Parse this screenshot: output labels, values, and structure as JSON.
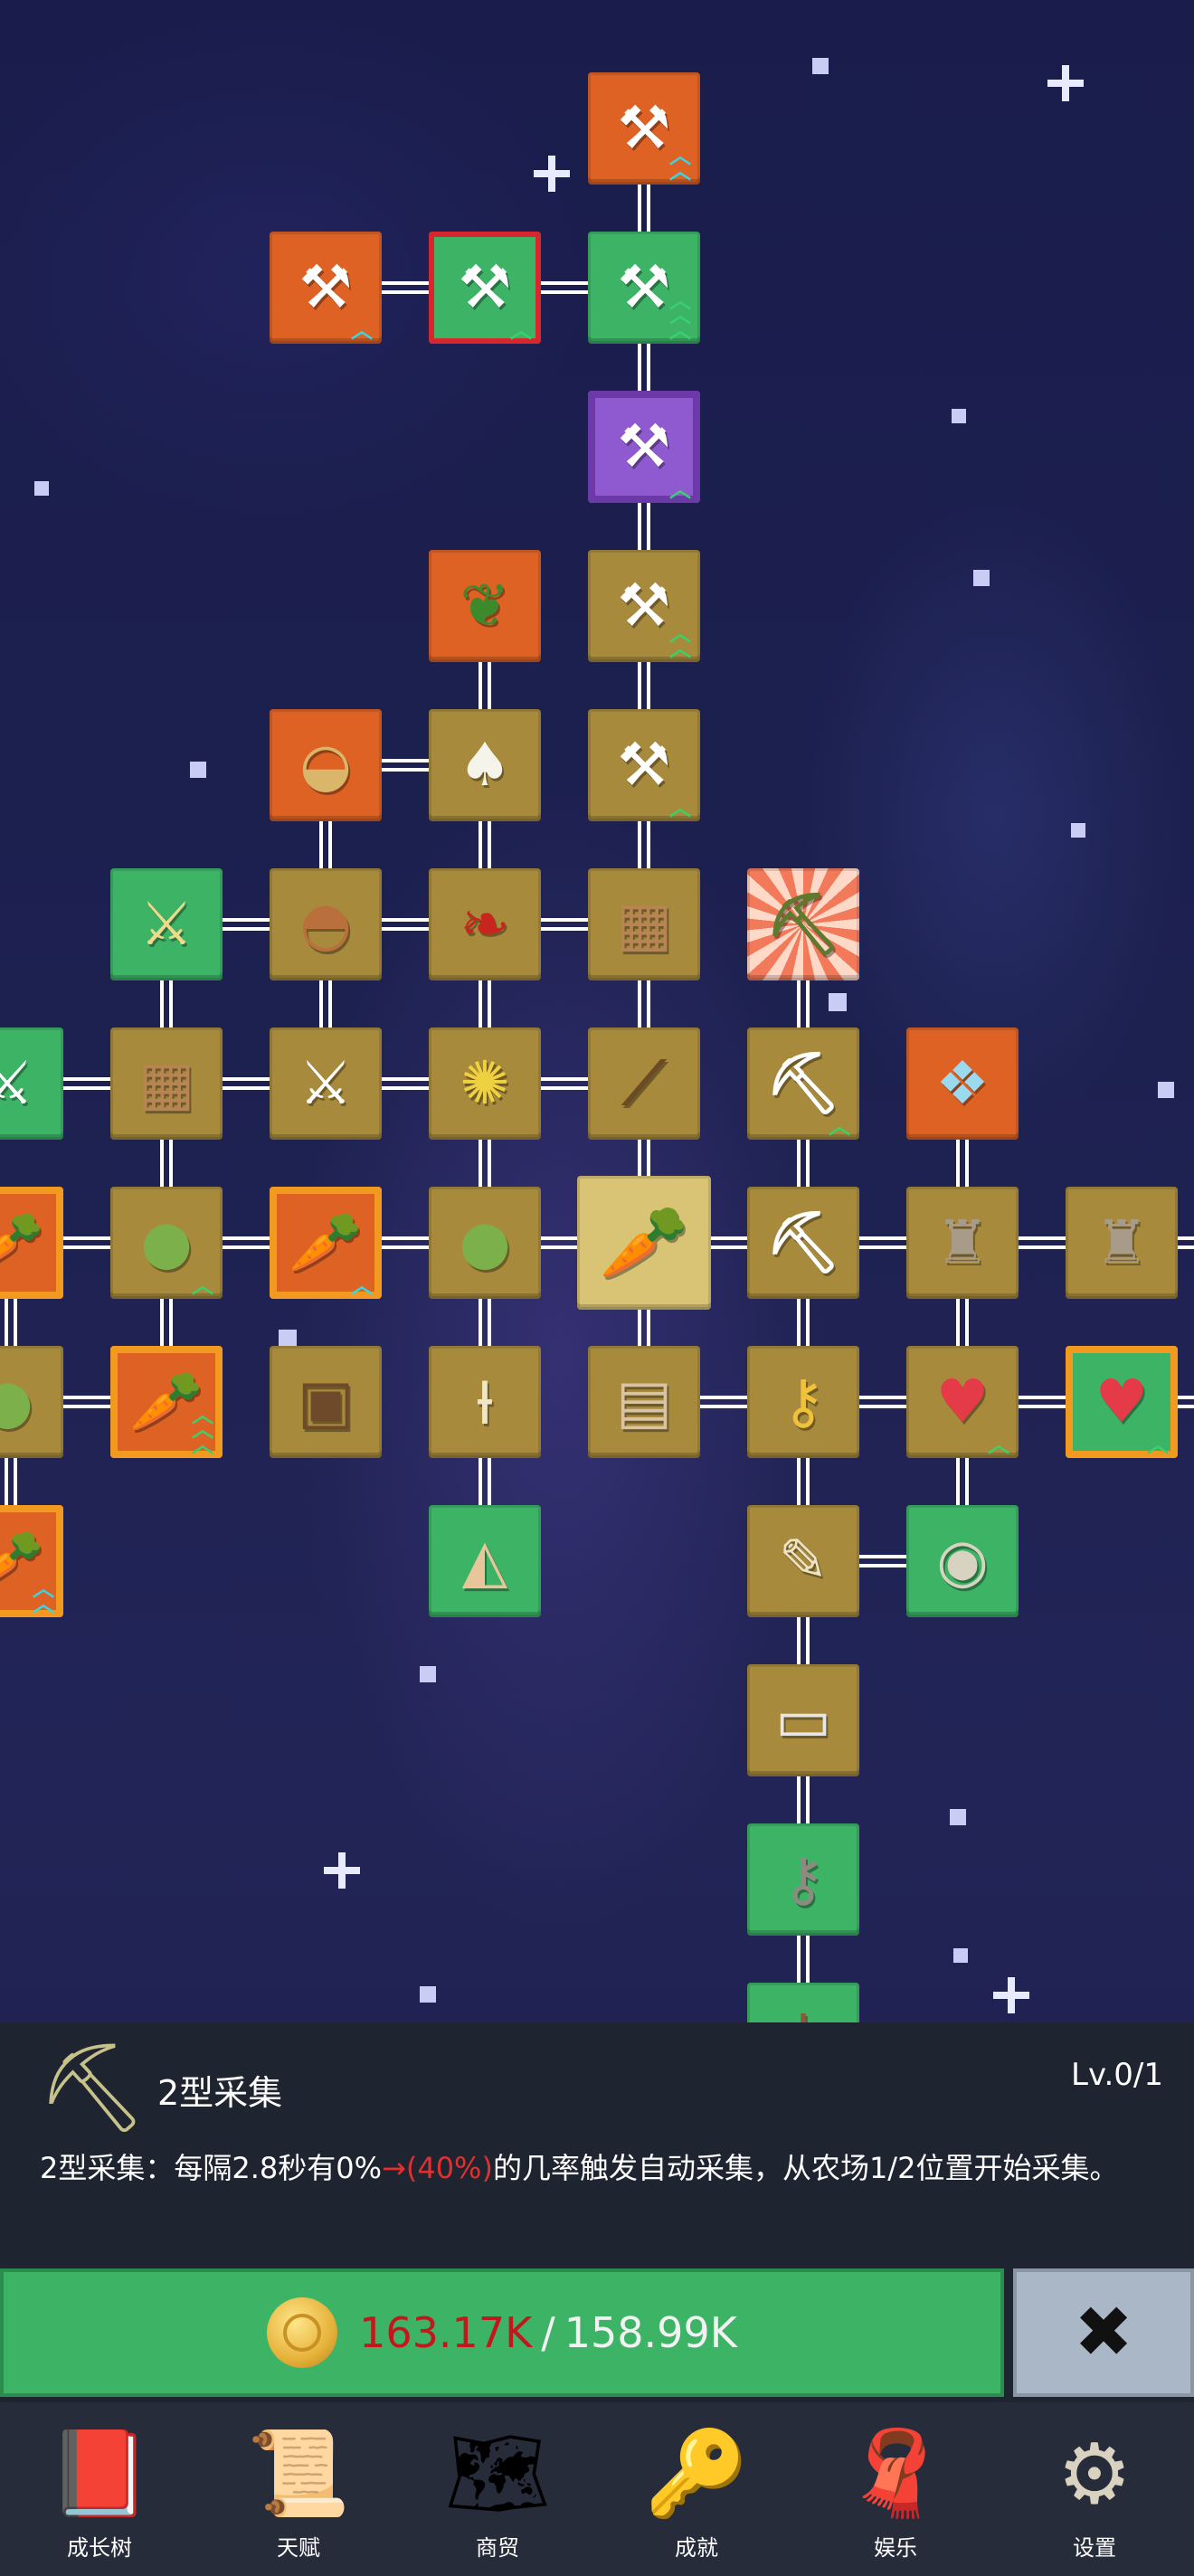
{
  "tree": {
    "nodes": [
      {
        "id": "shovel-top",
        "icon": "shovel-icon",
        "color": "orange",
        "chevrons": 2,
        "chev_color": "cyan"
      },
      {
        "id": "shovel-left",
        "icon": "shovel-icon",
        "color": "orange",
        "chevrons": 1,
        "chev_color": "cyan"
      },
      {
        "id": "shovel-red",
        "icon": "shovel-icon",
        "color": "green",
        "chevrons": 1,
        "chev_color": "green",
        "frame": "red"
      },
      {
        "id": "shovel-green",
        "icon": "shovel-icon",
        "color": "green",
        "chevrons": 3,
        "chev_color": "green"
      },
      {
        "id": "shovel-purple",
        "icon": "shovel-icon",
        "color": "brown",
        "chevrons": 1,
        "chev_color": "green",
        "frame": "purple"
      },
      {
        "id": "pepper",
        "icon": "bell-pepper-icon",
        "color": "orange"
      },
      {
        "id": "shovel-2",
        "icon": "shovel-icon",
        "color": "brown",
        "chevrons": 2,
        "chev_color": "green"
      },
      {
        "id": "soup-bowl",
        "icon": "soup-bowl-icon",
        "color": "orange"
      },
      {
        "id": "radish",
        "icon": "radish-icon",
        "color": "brown"
      },
      {
        "id": "shovel-3",
        "icon": "shovel-icon",
        "color": "brown",
        "chevrons": 1,
        "chev_color": "green"
      },
      {
        "id": "sword-green",
        "icon": "sword-icon",
        "color": "green"
      },
      {
        "id": "empty-bowl",
        "icon": "bowl-icon",
        "color": "brown"
      },
      {
        "id": "chili",
        "icon": "chili-icon",
        "color": "brown"
      },
      {
        "id": "backpack-1",
        "icon": "backpack-icon",
        "color": "brown"
      },
      {
        "id": "pickaxe-burst",
        "icon": "pickaxe-icon",
        "color": "burst"
      },
      {
        "id": "sword-edge",
        "icon": "sword-icon",
        "color": "green"
      },
      {
        "id": "backpack-2",
        "icon": "backpack-icon",
        "color": "brown"
      },
      {
        "id": "sword-2",
        "icon": "sword-icon",
        "color": "brown"
      },
      {
        "id": "corn",
        "icon": "corn-icon",
        "color": "brown"
      },
      {
        "id": "fishing-rod",
        "icon": "fishing-rod-icon",
        "color": "brown"
      },
      {
        "id": "pickaxe-2",
        "icon": "pickaxe-icon",
        "color": "brown",
        "chevrons": 1,
        "chev_color": "green"
      },
      {
        "id": "crystal",
        "icon": "crystal-icon",
        "color": "orange"
      },
      {
        "id": "carrot-edge",
        "icon": "carrot-icon",
        "color": "orange",
        "frame": "orange"
      },
      {
        "id": "cabbage-1",
        "icon": "cabbage-icon",
        "color": "brown",
        "chevrons": 1,
        "chev_color": "green"
      },
      {
        "id": "carrot-2",
        "icon": "carrot-icon",
        "color": "orange",
        "frame": "orange",
        "chevrons": 1,
        "chev_color": "cyan"
      },
      {
        "id": "cabbage-2",
        "icon": "cabbage-icon",
        "color": "brown"
      },
      {
        "id": "carrot-center",
        "icon": "carrot-icon",
        "color": "highlight"
      },
      {
        "id": "pickaxe-3",
        "icon": "pickaxe-icon",
        "color": "brown"
      },
      {
        "id": "statue-1",
        "icon": "statue-icon",
        "color": "brown"
      },
      {
        "id": "statue-2",
        "icon": "statue-icon",
        "color": "brown"
      },
      {
        "id": "cabbage-edge",
        "icon": "cabbage-icon",
        "color": "brown"
      },
      {
        "id": "carrot-3",
        "icon": "carrot-icon",
        "color": "orange",
        "frame": "orange",
        "chevrons": 3,
        "chev_color": "green"
      },
      {
        "id": "chest",
        "icon": "treasure-chest-icon",
        "color": "brown"
      },
      {
        "id": "leek",
        "icon": "leek-icon",
        "color": "brown"
      },
      {
        "id": "map",
        "icon": "map-icon",
        "color": "brown"
      },
      {
        "id": "golden-key",
        "icon": "golden-key-icon",
        "color": "brown"
      },
      {
        "id": "heart-1",
        "icon": "heart-icon",
        "color": "brown",
        "chevrons": 1,
        "chev_color": "green"
      },
      {
        "id": "heart-2",
        "icon": "heart-icon",
        "color": "green",
        "frame": "orange",
        "chevrons": 1,
        "chev_color": "green"
      },
      {
        "id": "carrot-edge-2",
        "icon": "carrot-icon",
        "color": "orange",
        "frame": "orange",
        "chevrons": 2,
        "chev_color": "cyan"
      },
      {
        "id": "pizza",
        "icon": "pizza-icon",
        "color": "green"
      },
      {
        "id": "scroll",
        "icon": "scroll-icon",
        "color": "brown"
      },
      {
        "id": "fossil",
        "icon": "fossil-icon",
        "color": "green"
      },
      {
        "id": "cassette",
        "icon": "cassette-icon",
        "color": "brown"
      },
      {
        "id": "key",
        "icon": "key-icon",
        "color": "green"
      },
      {
        "id": "cloth",
        "icon": "cloth-icon",
        "color": "green"
      }
    ]
  },
  "detail": {
    "icon": "pickaxe-icon",
    "title": "2型采集",
    "level": "Lv.0/1",
    "desc_prefix": "2型采集：每隔2.8秒有0%",
    "desc_highlight": "→(40%)",
    "desc_suffix": "的几率触发自动采集，从农场1/2位置开始采集。"
  },
  "upgrade": {
    "icon": "coin-icon",
    "cost_current": "163.17K",
    "separator": "/",
    "cost_have": "158.99K",
    "colors": {
      "insufficient": "#c4161c",
      "button": "#3db366"
    }
  },
  "close": {
    "icon": "close-x-icon",
    "glyph": "✖"
  },
  "tabs": [
    {
      "label": "成长树",
      "icon": "book-icon",
      "glyph": "📕"
    },
    {
      "label": "天赋",
      "icon": "scroll-icon",
      "glyph": "📜"
    },
    {
      "label": "商贸",
      "icon": "map-icon",
      "glyph": "🗺"
    },
    {
      "label": "成就",
      "icon": "golden-key-icon",
      "glyph": "🔑"
    },
    {
      "label": "娱乐",
      "icon": "cloth-icon",
      "glyph": "🧣"
    },
    {
      "label": "设置",
      "icon": "gear-icon",
      "glyph": "⚙"
    }
  ]
}
